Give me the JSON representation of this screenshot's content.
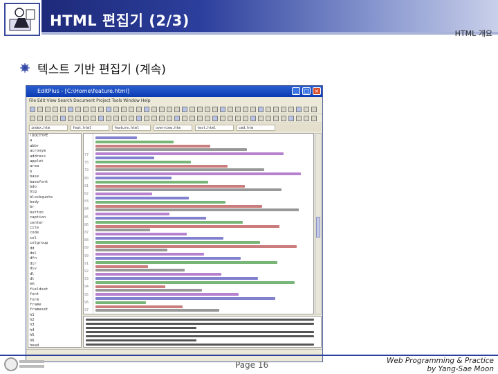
{
  "header": {
    "title": "HTML 편집기 (2/3)",
    "section": "HTML 개요"
  },
  "bullet": {
    "text": "텍스트 기반 편집기 (계속)"
  },
  "screenshot": {
    "window_title": "EditPlus - [C:\\Home\\feature.html]",
    "menu": "File  Edit  View  Search  Document  Project  Tools  Window  Help",
    "tabs": [
      "index.htm",
      "feat.html",
      "feature.html",
      "overview.htm",
      "test.html",
      "cmd.htm"
    ],
    "dir_items": [
      "!DOCTYPE",
      "a",
      "abbr",
      "acronym",
      "address",
      "applet",
      "area",
      "b",
      "base",
      "basefont",
      "bdo",
      "big",
      "blockquote",
      "body",
      "br",
      "button",
      "caption",
      "center",
      "cite",
      "code",
      "col",
      "colgroup",
      "dd",
      "del",
      "dfn",
      "dir",
      "div",
      "dl",
      "dt",
      "em",
      "fieldset",
      "font",
      "form",
      "frame",
      "frameset",
      "h1",
      "h2",
      "h3",
      "h4",
      "h5",
      "h6",
      "head"
    ],
    "line_numbers": [
      "77",
      "78",
      "79",
      "80",
      "81",
      "82",
      "83",
      "84",
      "85",
      "86",
      "87",
      "88",
      "89",
      "90",
      "91",
      "92",
      "93",
      "94",
      "95",
      "96",
      "97"
    ]
  },
  "footer": {
    "page": "Page 16",
    "course_line1": "Web Programming & Practice",
    "course_line2": "by Yang-Sae Moon"
  },
  "colors": {
    "brand_dark": "#1e2a7a",
    "brand_mid": "#2c3f9c",
    "window_title": "#0b3bb3"
  }
}
